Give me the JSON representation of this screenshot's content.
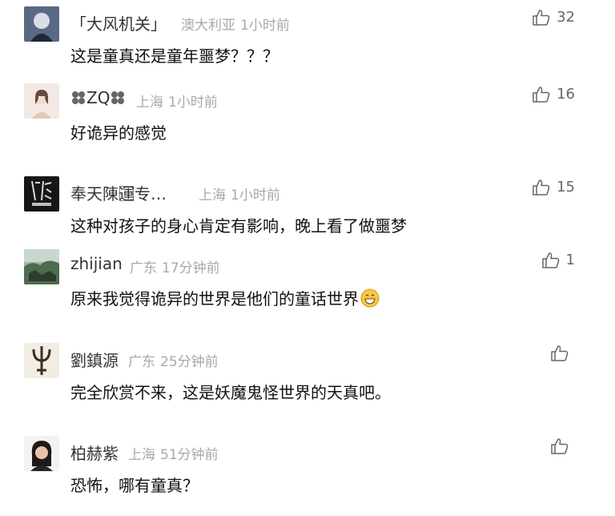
{
  "comments": [
    {
      "username": "「大风机关」",
      "location": "澳大利亚",
      "time": "1小时前",
      "text": "这是童真还是童年噩梦？？？",
      "likes": "32",
      "avatar": "anime-portrait-avatar"
    },
    {
      "username": "ZQ",
      "location": "上海",
      "time": "1小时前",
      "text": "好诡异的感觉",
      "likes": "16",
      "avatar": "girl-illustration-avatar"
    },
    {
      "username": "奉天陳運⃞专…",
      "location": "上海",
      "time": "1小时前",
      "text": "这种对孩子的身心肯定有影响，晚上看了做噩梦",
      "likes": "15",
      "avatar": "calligraphy-logo-avatar"
    },
    {
      "username": "zhijian",
      "location": "广东",
      "time": "17分钟前",
      "text": "原来我觉得诡异的世界是他们的童话世界",
      "likes": "1",
      "avatar": "landscape-photo-avatar"
    },
    {
      "username": "劉鎮源",
      "location": "广东",
      "time": "25分钟前",
      "text": "完全欣赏不来，这是妖魔鬼怪世界的天真吧。",
      "likes": "",
      "avatar": "trident-glyph-avatar"
    },
    {
      "username": "柏赫紫",
      "location": "上海",
      "time": "51分钟前",
      "text": "恐怖，哪有童真？",
      "likes": "",
      "avatar": "woman-portrait-avatar"
    }
  ],
  "icons": {
    "like": "thumbs-up-icon",
    "emoji": "grinning-face-emoji",
    "name_decoration": "clover-icon"
  },
  "colors": {
    "meta": "#a8a8a8",
    "name": "#333333",
    "text": "#111111",
    "like": "#666666"
  }
}
